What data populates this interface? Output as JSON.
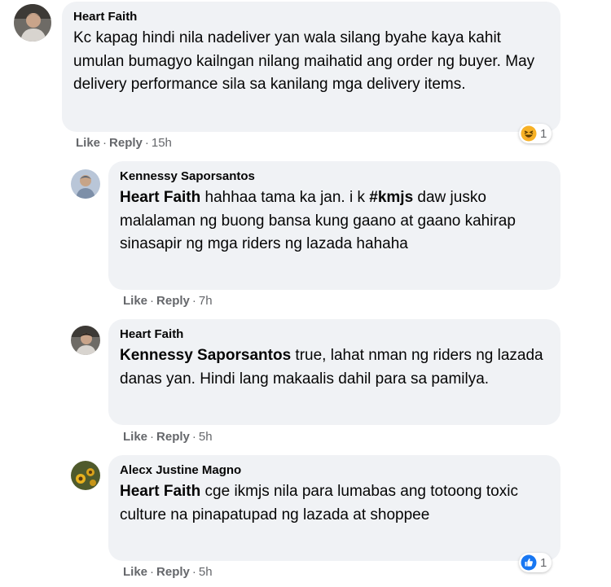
{
  "comments": [
    {
      "author": "Heart Faith",
      "text": "Kc kapag hindi nila nadeliver yan wala silang byahe kaya kahit umulan bumagyo kailngan nilang maihatid ang order ng buyer. May delivery performance sila sa kanilang mga delivery items.",
      "like_label": "Like",
      "reply_label": "Reply",
      "time": "15h",
      "reaction": {
        "icon": "haha-reaction-icon",
        "count": "1"
      }
    },
    {
      "author": "Kennessy Saporsantos",
      "mention": "Heart Faith",
      "text_a": " hahhaa tama ka jan. i k ",
      "hashtag": "#kmjs",
      "text_b": " daw jusko malalaman ng buong bansa kung gaano at gaano kahirap sinasapir ng mga riders ng lazada hahaha",
      "like_label": "Like",
      "reply_label": "Reply",
      "time": "7h"
    },
    {
      "author": "Heart Faith",
      "mention": "Kennessy Saporsantos",
      "text": " true, lahat nman ng riders ng lazada danas yan. Hindi lang makaalis dahil para sa pamilya.",
      "like_label": "Like",
      "reply_label": "Reply",
      "time": "5h"
    },
    {
      "author": "Alecx Justine Magno",
      "mention": "Heart Faith",
      "text": " cge ikmjs nila para lumabas ang totoong toxic culture na pinapatupad ng lazada at shoppee",
      "like_label": "Like",
      "reply_label": "Reply",
      "time": "5h",
      "reaction": {
        "icon": "like-reaction-icon",
        "count": "1"
      }
    }
  ],
  "colors": {
    "bubble": "#f0f2f5",
    "meta_text": "#65676b",
    "like_blue": "#1877f2",
    "haha_yellow": "#f7b125"
  }
}
